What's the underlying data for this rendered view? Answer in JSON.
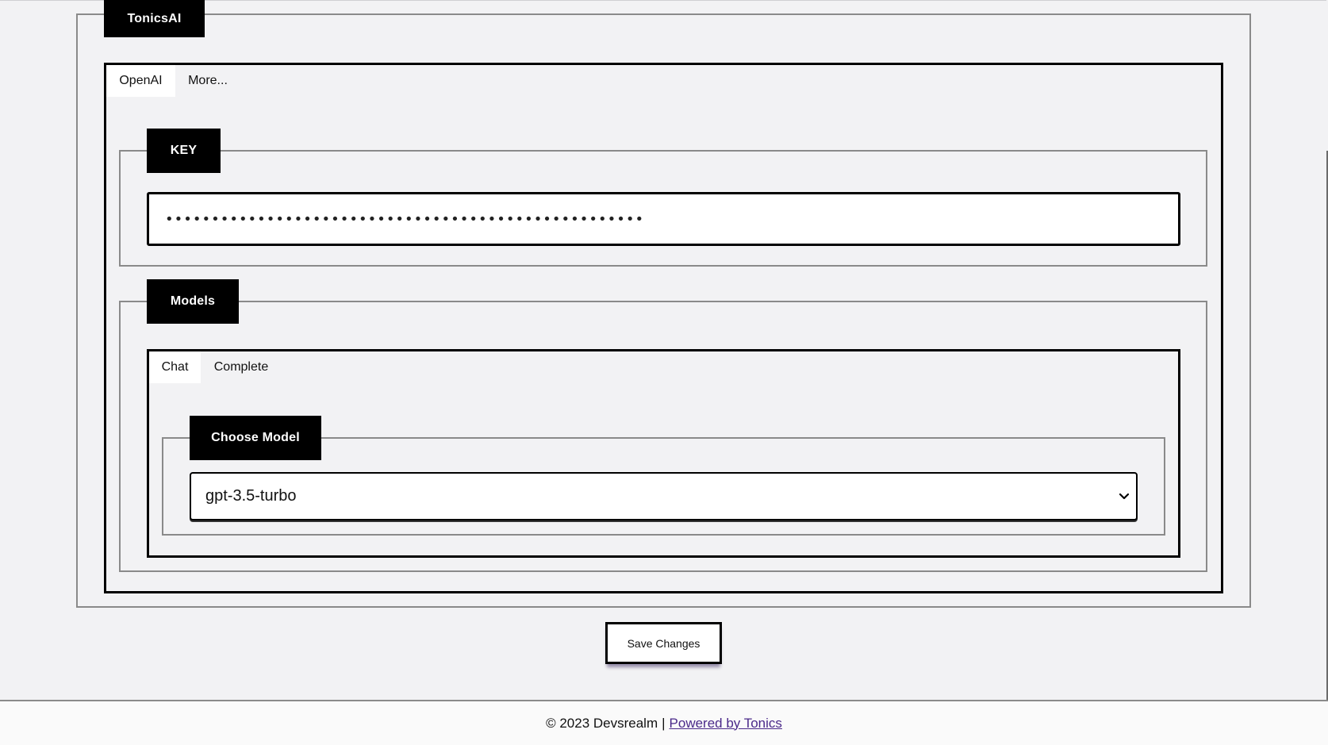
{
  "settings": {
    "section_title": "TonicsAI",
    "provider_tabs": [
      {
        "label": "OpenAI",
        "active": true
      },
      {
        "label": "More...",
        "active": false
      }
    ],
    "key": {
      "legend": "KEY",
      "masked_value": "••••••••••••••••••••••••••••••••••••••••••••••••••••"
    },
    "models": {
      "legend": "Models",
      "tabs": [
        {
          "label": "Chat",
          "active": true
        },
        {
          "label": "Complete",
          "active": false
        }
      ],
      "choose": {
        "legend": "Choose Model",
        "selected": "gpt-3.5-turbo"
      }
    },
    "save_label": "Save Changes"
  },
  "footer": {
    "copyright": "© 2023 Devsrealm",
    "separator": "|",
    "link_label": "Powered by Tonics"
  },
  "icons": {
    "select_arrow": "chevron-down-icon"
  }
}
